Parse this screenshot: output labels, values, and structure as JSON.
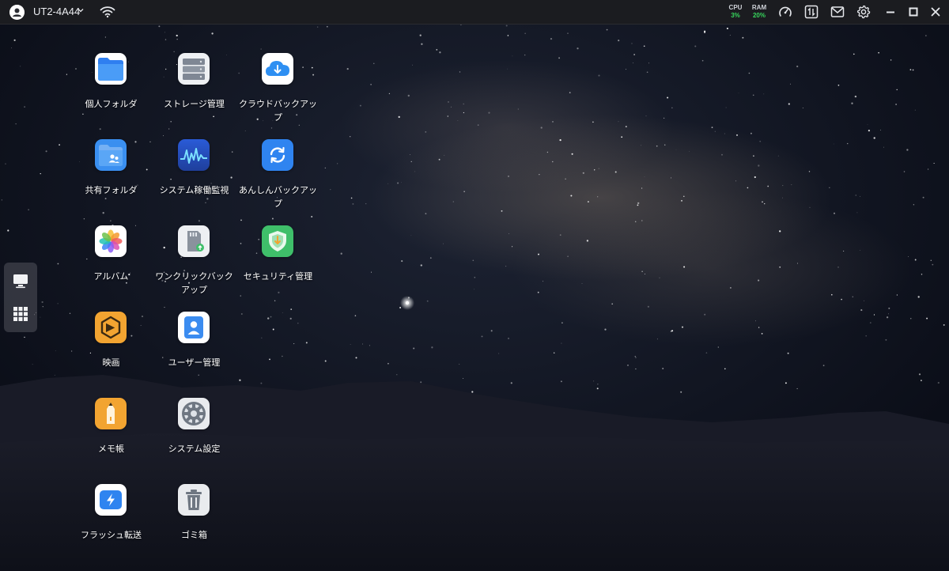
{
  "topbar": {
    "device_name": "UT2-4A44",
    "cpu": {
      "label": "CPU",
      "value": "3%"
    },
    "ram": {
      "label": "RAM",
      "value": "20%"
    }
  },
  "apps": [
    {
      "label": "個人フォルダ",
      "icon": "personal-folder-icon"
    },
    {
      "label": "ストレージ管理",
      "icon": "storage-icon"
    },
    {
      "label": "クラウドバックアップ",
      "icon": "cloud-backup-icon"
    },
    {
      "label": "共有フォルダ",
      "icon": "shared-folder-icon"
    },
    {
      "label": "システム稼働監視",
      "icon": "system-monitor-icon"
    },
    {
      "label": "あんしんバックアップ",
      "icon": "sync-backup-icon"
    },
    {
      "label": "アルバム",
      "icon": "album-icon"
    },
    {
      "label": "ワンクリックバックアップ",
      "icon": "sd-card-backup-icon"
    },
    {
      "label": "セキュリティ管理",
      "icon": "security-shield-icon"
    },
    {
      "label": "映画",
      "icon": "movie-icon"
    },
    {
      "label": "ユーザー管理",
      "icon": "user-management-icon"
    },
    {
      "label": "メモ帳",
      "icon": "notepad-icon"
    },
    {
      "label": "システム設定",
      "icon": "settings-gear-icon"
    },
    {
      "label": "フラッシュ転送",
      "icon": "flash-transfer-icon"
    },
    {
      "label": "ゴミ箱",
      "icon": "trash-icon"
    }
  ],
  "colors": {
    "topbar_bg": "#1b1c20",
    "stat_value": "#37d65c",
    "folder_blue": "#3a8ff0",
    "security_green": "#3fbf6a",
    "movie_orange": "#f2a431"
  }
}
